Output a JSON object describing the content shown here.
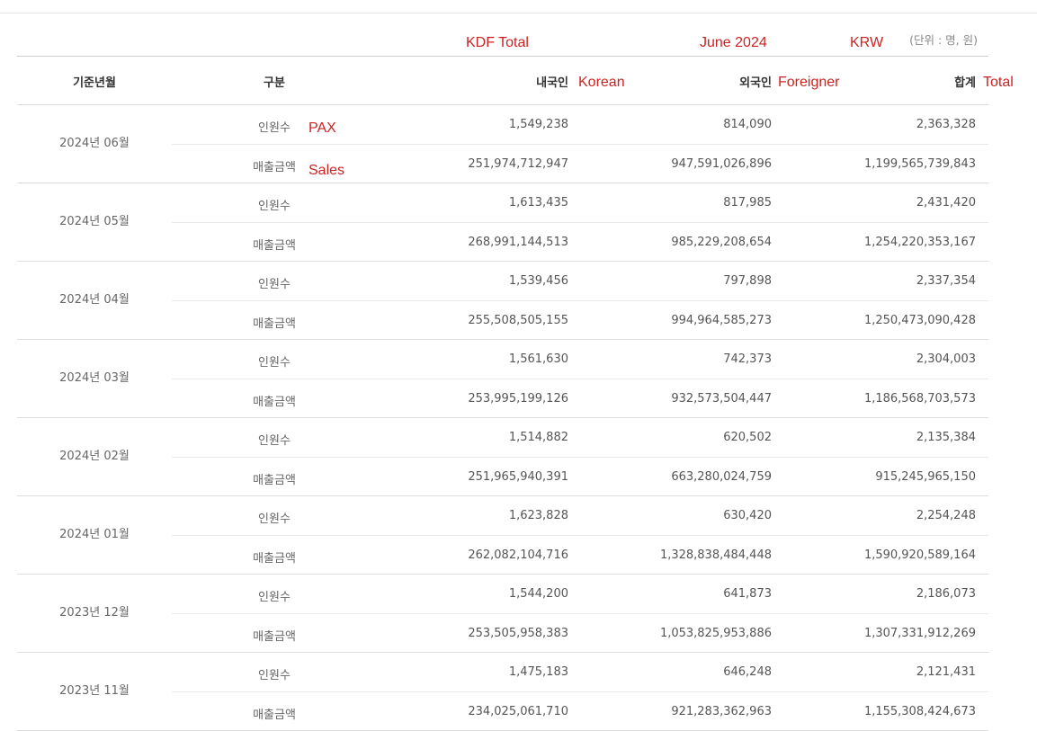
{
  "annotations": {
    "kdf_total": "KDF Total",
    "period": "June 2024",
    "currency": "KRW",
    "korean": "Korean",
    "foreigner": "Foreigner",
    "total": "Total",
    "pax": "PAX",
    "sales": "Sales"
  },
  "unit_note": "(단위 : 명, 원)",
  "header": {
    "month": "기준년월",
    "type": "구분",
    "korean": "내국인",
    "foreigner": "외국인",
    "total": "합계"
  },
  "row_types": {
    "pax": "인원수",
    "sales": "매출금액"
  },
  "rows": [
    {
      "month": "2024년 06월",
      "pax": {
        "korean": "1,549,238",
        "foreigner": "814,090",
        "total": "2,363,328"
      },
      "sales": {
        "korean": "251,974,712,947",
        "foreigner": "947,591,026,896",
        "total": "1,199,565,739,843"
      }
    },
    {
      "month": "2024년 05월",
      "pax": {
        "korean": "1,613,435",
        "foreigner": "817,985",
        "total": "2,431,420"
      },
      "sales": {
        "korean": "268,991,144,513",
        "foreigner": "985,229,208,654",
        "total": "1,254,220,353,167"
      }
    },
    {
      "month": "2024년 04월",
      "pax": {
        "korean": "1,539,456",
        "foreigner": "797,898",
        "total": "2,337,354"
      },
      "sales": {
        "korean": "255,508,505,155",
        "foreigner": "994,964,585,273",
        "total": "1,250,473,090,428"
      }
    },
    {
      "month": "2024년 03월",
      "pax": {
        "korean": "1,561,630",
        "foreigner": "742,373",
        "total": "2,304,003"
      },
      "sales": {
        "korean": "253,995,199,126",
        "foreigner": "932,573,504,447",
        "total": "1,186,568,703,573"
      }
    },
    {
      "month": "2024년 02월",
      "pax": {
        "korean": "1,514,882",
        "foreigner": "620,502",
        "total": "2,135,384"
      },
      "sales": {
        "korean": "251,965,940,391",
        "foreigner": "663,280,024,759",
        "total": "915,245,965,150"
      }
    },
    {
      "month": "2024년 01월",
      "pax": {
        "korean": "1,623,828",
        "foreigner": "630,420",
        "total": "2,254,248"
      },
      "sales": {
        "korean": "262,082,104,716",
        "foreigner": "1,328,838,484,448",
        "total": "1,590,920,589,164"
      }
    },
    {
      "month": "2023년 12월",
      "pax": {
        "korean": "1,544,200",
        "foreigner": "641,873",
        "total": "2,186,073"
      },
      "sales": {
        "korean": "253,505,958,383",
        "foreigner": "1,053,825,953,886",
        "total": "1,307,331,912,269"
      }
    },
    {
      "month": "2023년 11월",
      "pax": {
        "korean": "1,475,183",
        "foreigner": "646,248",
        "total": "2,121,431"
      },
      "sales": {
        "korean": "234,025,061,710",
        "foreigner": "921,283,362,963",
        "total": "1,155,308,424,673"
      }
    }
  ]
}
